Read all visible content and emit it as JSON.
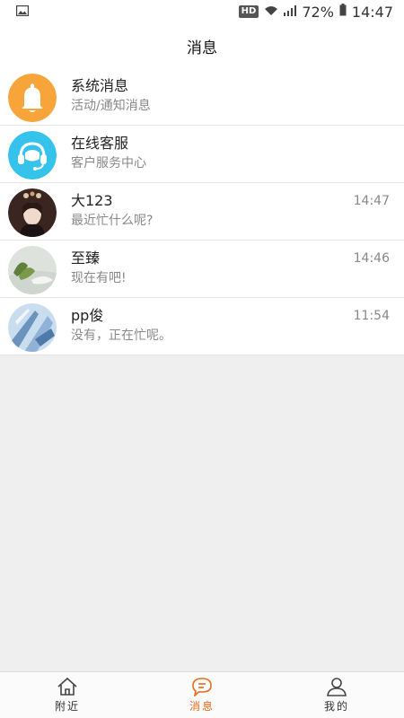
{
  "status_bar": {
    "left_icon": "gallery-notification-icon",
    "network_badge": "HD",
    "battery_percent": "72%",
    "time": "14:47"
  },
  "header": {
    "title": "消息"
  },
  "messages": [
    {
      "name": "系统消息",
      "preview": "活动/通知消息",
      "time": "",
      "avatar": "bell-icon"
    },
    {
      "name": "在线客服",
      "preview": "客户服务中心",
      "time": "",
      "avatar": "headset-icon"
    },
    {
      "name": "大123",
      "preview": "最近忙什么呢?",
      "time": "14:47",
      "avatar": "user-photo"
    },
    {
      "name": "至臻",
      "preview": "现在有吧!",
      "time": "14:46",
      "avatar": "user-photo"
    },
    {
      "name": "pp俊",
      "preview": "没有，正在忙呢。",
      "time": "11:54",
      "avatar": "user-photo"
    }
  ],
  "tabbar": {
    "items": [
      {
        "label": "附近",
        "icon": "home-icon"
      },
      {
        "label": "消息",
        "icon": "chat-icon"
      },
      {
        "label": "我的",
        "icon": "person-icon"
      }
    ],
    "active": 1
  },
  "colors": {
    "accent": "#e86a1a",
    "bell_bg": "#f7a53a",
    "headset_bg": "#35c3ec",
    "background": "#efeff0"
  }
}
